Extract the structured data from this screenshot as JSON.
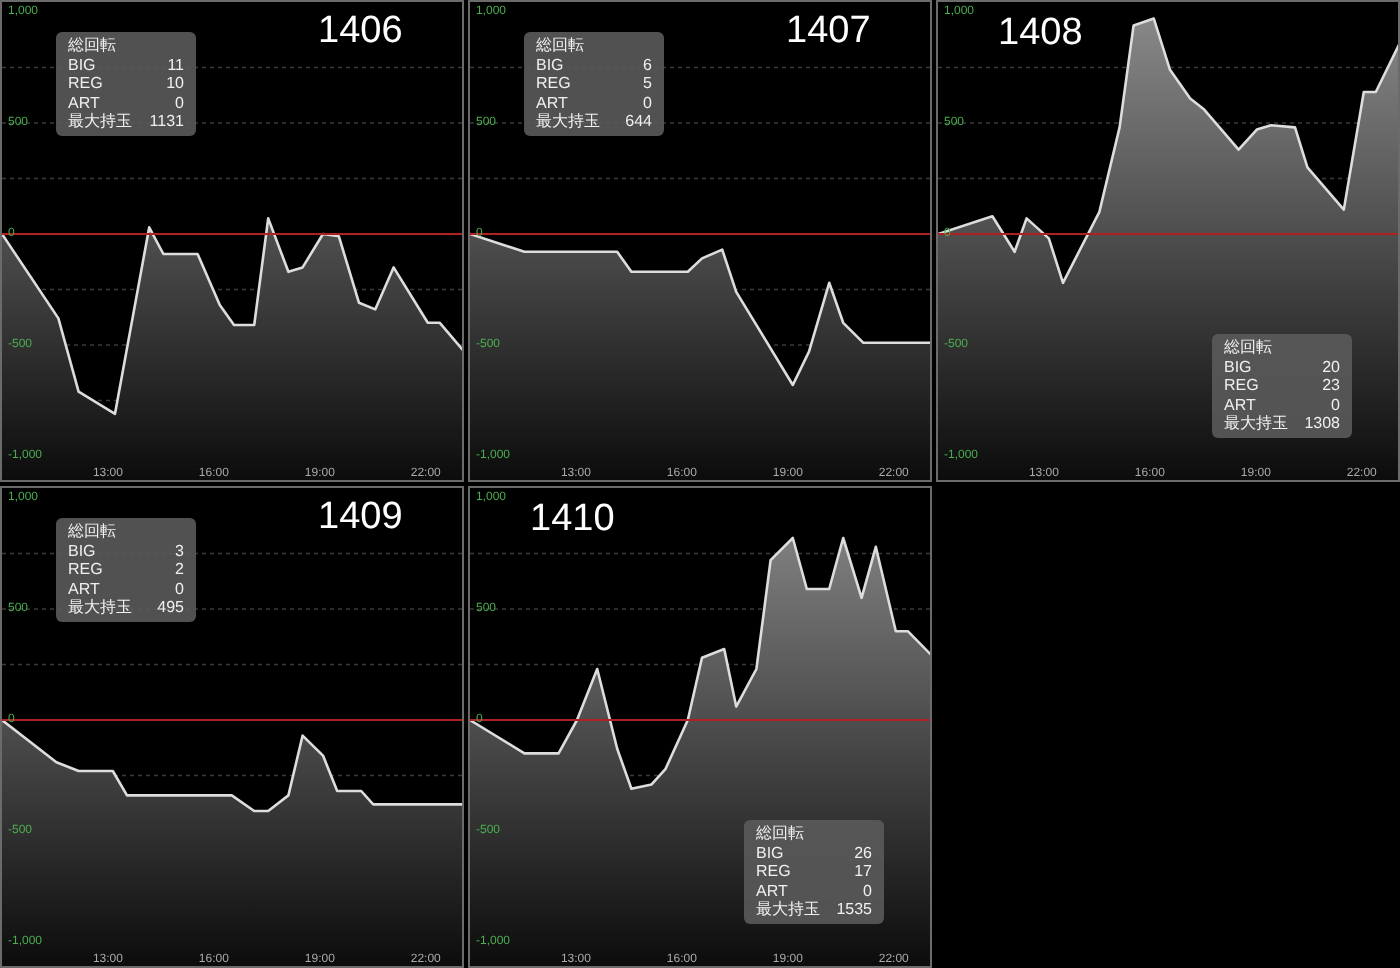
{
  "panels": [
    {
      "stats_at_bottom": false,
      "stats": {
        "heading": "総回転",
        "rows": [
          {
            "label": "BIG",
            "value": "11"
          },
          {
            "label": "REG",
            "value": "10"
          },
          {
            "label": "ART",
            "value": "0"
          },
          {
            "label": "最大持玉",
            "value": "1131"
          }
        ]
      },
      "chart_data": {
        "type": "area",
        "title": "1406",
        "xlim": [
          10,
          23.14
        ],
        "ylim": [
          -1108,
          1045
        ],
        "xticks": [
          {
            "value": 13,
            "label": "13:00"
          },
          {
            "value": 16,
            "label": "16:00"
          },
          {
            "value": 19,
            "label": "19:00"
          },
          {
            "value": 22,
            "label": "22:00"
          }
        ],
        "yticks": [
          {
            "value": 1000,
            "label": "1,000"
          },
          {
            "value": 500,
            "label": "500"
          },
          {
            "value": 0,
            "label": "0"
          },
          {
            "value": -500,
            "label": "-500"
          },
          {
            "value": -1000,
            "label": "-1,000"
          }
        ],
        "ref_lines": [
          {
            "axis": "y",
            "value": 0,
            "color": "#b02020"
          }
        ],
        "x": [
          10,
          11.6,
          12.17,
          13.2,
          14.17,
          14.57,
          15.54,
          16.17,
          16.57,
          17.14,
          17.54,
          18.11,
          18.51,
          19.09,
          19.54,
          20.11,
          20.57,
          21.09,
          22.06,
          22.4,
          23.14
        ],
        "series": [
          {
            "color": "#dddddd",
            "values": [
              0,
              -380,
              -710,
              -810,
              30,
              -90,
              -90,
              -320,
              -410,
              -410,
              70,
              -170,
              -150,
              0,
              -10,
              -310,
              -340,
              -150,
              -400,
              -400,
              -540
            ]
          }
        ]
      }
    },
    {
      "stats_at_bottom": false,
      "stats": {
        "heading": "総回転",
        "rows": [
          {
            "label": "BIG",
            "value": "6"
          },
          {
            "label": "REG",
            "value": "5"
          },
          {
            "label": "ART",
            "value": "0"
          },
          {
            "label": "最大持玉",
            "value": "644"
          }
        ]
      },
      "chart_data": {
        "type": "area",
        "title": "1407",
        "xlim": [
          10,
          23.14
        ],
        "ylim": [
          -1108,
          1045
        ],
        "xticks": [
          {
            "value": 13,
            "label": "13:00"
          },
          {
            "value": 16,
            "label": "16:00"
          },
          {
            "value": 19,
            "label": "19:00"
          },
          {
            "value": 22,
            "label": "22:00"
          }
        ],
        "yticks": [
          {
            "value": 1000,
            "label": "1,000"
          },
          {
            "value": 500,
            "label": "500"
          },
          {
            "value": 0,
            "label": "0"
          },
          {
            "value": -500,
            "label": "-500"
          },
          {
            "value": -1000,
            "label": "-1,000"
          }
        ],
        "ref_lines": [
          {
            "axis": "y",
            "value": 0,
            "color": "#b02020"
          }
        ],
        "x": [
          10,
          11.54,
          14.17,
          14.57,
          16.17,
          16.57,
          17.14,
          17.54,
          19.14,
          19.6,
          20.17,
          20.57,
          21.14,
          23.14
        ],
        "series": [
          {
            "color": "#dddddd",
            "values": [
              0,
              -80,
              -80,
              -170,
              -170,
              -110,
              -70,
              -260,
              -680,
              -530,
              -220,
              -400,
              -490,
              -490
            ]
          }
        ]
      }
    },
    {
      "stats_at_bottom": true,
      "stats": {
        "heading": "総回転",
        "rows": [
          {
            "label": "BIG",
            "value": "20"
          },
          {
            "label": "REG",
            "value": "23"
          },
          {
            "label": "ART",
            "value": "0"
          },
          {
            "label": "最大持玉",
            "value": "1308"
          }
        ]
      },
      "chart_data": {
        "type": "area",
        "title": "1408",
        "xlim": [
          10,
          23.14
        ],
        "ylim": [
          -1108,
          1045
        ],
        "xticks": [
          {
            "value": 13,
            "label": "13:00"
          },
          {
            "value": 16,
            "label": "16:00"
          },
          {
            "value": 19,
            "label": "19:00"
          },
          {
            "value": 22,
            "label": "22:00"
          }
        ],
        "yticks": [
          {
            "value": 1000,
            "label": "1,000"
          },
          {
            "value": 500,
            "label": "500"
          },
          {
            "value": 0,
            "label": "0"
          },
          {
            "value": -500,
            "label": "-500"
          },
          {
            "value": -1000,
            "label": "-1,000"
          }
        ],
        "ref_lines": [
          {
            "axis": "y",
            "value": 0,
            "color": "#b02020"
          }
        ],
        "x": [
          10,
          11.54,
          12.17,
          12.51,
          13.14,
          13.54,
          14.57,
          15.14,
          15.54,
          16.11,
          16.57,
          17.14,
          17.54,
          18.51,
          19.03,
          19.43,
          20.11,
          20.46,
          21.49,
          22.06,
          22.4,
          23.14
        ],
        "series": [
          {
            "color": "#dddddd",
            "values": [
              0,
              80,
              -80,
              70,
              -20,
              -220,
              100,
              480,
              940,
              970,
              740,
              610,
              560,
              380,
              470,
              490,
              480,
              300,
              110,
              640,
              640,
              880
            ]
          }
        ]
      }
    },
    {
      "stats_at_bottom": false,
      "stats": {
        "heading": "総回転",
        "rows": [
          {
            "label": "BIG",
            "value": "3"
          },
          {
            "label": "REG",
            "value": "2"
          },
          {
            "label": "ART",
            "value": "0"
          },
          {
            "label": "最大持玉",
            "value": "495"
          }
        ]
      },
      "chart_data": {
        "type": "area",
        "title": "1409",
        "xlim": [
          10,
          23.14
        ],
        "ylim": [
          -1108,
          1045
        ],
        "xticks": [
          {
            "value": 13,
            "label": "13:00"
          },
          {
            "value": 16,
            "label": "16:00"
          },
          {
            "value": 19,
            "label": "19:00"
          },
          {
            "value": 22,
            "label": "22:00"
          }
        ],
        "yticks": [
          {
            "value": 1000,
            "label": "1,000"
          },
          {
            "value": 500,
            "label": "500"
          },
          {
            "value": 0,
            "label": "0"
          },
          {
            "value": -500,
            "label": "-500"
          },
          {
            "value": -1000,
            "label": "-1,000"
          }
        ],
        "ref_lines": [
          {
            "axis": "y",
            "value": 0,
            "color": "#b02020"
          }
        ],
        "x": [
          10,
          11.54,
          12.17,
          13.14,
          13.54,
          16.51,
          17.14,
          17.54,
          18.11,
          18.51,
          19.09,
          19.49,
          20.17,
          20.51,
          23.14
        ],
        "series": [
          {
            "color": "#dddddd",
            "values": [
              0,
              -190,
              -230,
              -230,
              -340,
              -340,
              -410,
              -410,
              -340,
              -70,
              -160,
              -320,
              -320,
              -380,
              -380
            ]
          }
        ]
      }
    },
    {
      "stats_at_bottom": true,
      "stats": {
        "heading": "総回転",
        "rows": [
          {
            "label": "BIG",
            "value": "26"
          },
          {
            "label": "REG",
            "value": "17"
          },
          {
            "label": "ART",
            "value": "0"
          },
          {
            "label": "最大持玉",
            "value": "1535"
          }
        ]
      },
      "chart_data": {
        "type": "area",
        "title": "1410",
        "xlim": [
          10,
          23.14
        ],
        "ylim": [
          -1108,
          1045
        ],
        "xticks": [
          {
            "value": 13,
            "label": "13:00"
          },
          {
            "value": 16,
            "label": "16:00"
          },
          {
            "value": 19,
            "label": "19:00"
          },
          {
            "value": 22,
            "label": "22:00"
          }
        ],
        "yticks": [
          {
            "value": 1000,
            "label": "1,000"
          },
          {
            "value": 500,
            "label": "500"
          },
          {
            "value": 0,
            "label": "0"
          },
          {
            "value": -500,
            "label": "-500"
          },
          {
            "value": -1000,
            "label": "-1,000"
          }
        ],
        "ref_lines": [
          {
            "axis": "y",
            "value": 0,
            "color": "#b02020"
          }
        ],
        "x": [
          10,
          11.54,
          12.51,
          13.03,
          13.6,
          14.17,
          14.57,
          15.14,
          15.54,
          16.17,
          16.57,
          17.2,
          17.54,
          18.11,
          18.51,
          19.14,
          19.54,
          20.17,
          20.57,
          21.09,
          21.49,
          22.06,
          22.4,
          23.14
        ],
        "series": [
          {
            "color": "#dddddd",
            "values": [
              0,
              -150,
              -150,
              0,
              230,
              -130,
              -310,
              -290,
              -220,
              0,
              280,
              320,
              60,
              230,
              720,
              820,
              590,
              590,
              820,
              550,
              780,
              400,
              400,
              280
            ]
          }
        ]
      }
    }
  ]
}
